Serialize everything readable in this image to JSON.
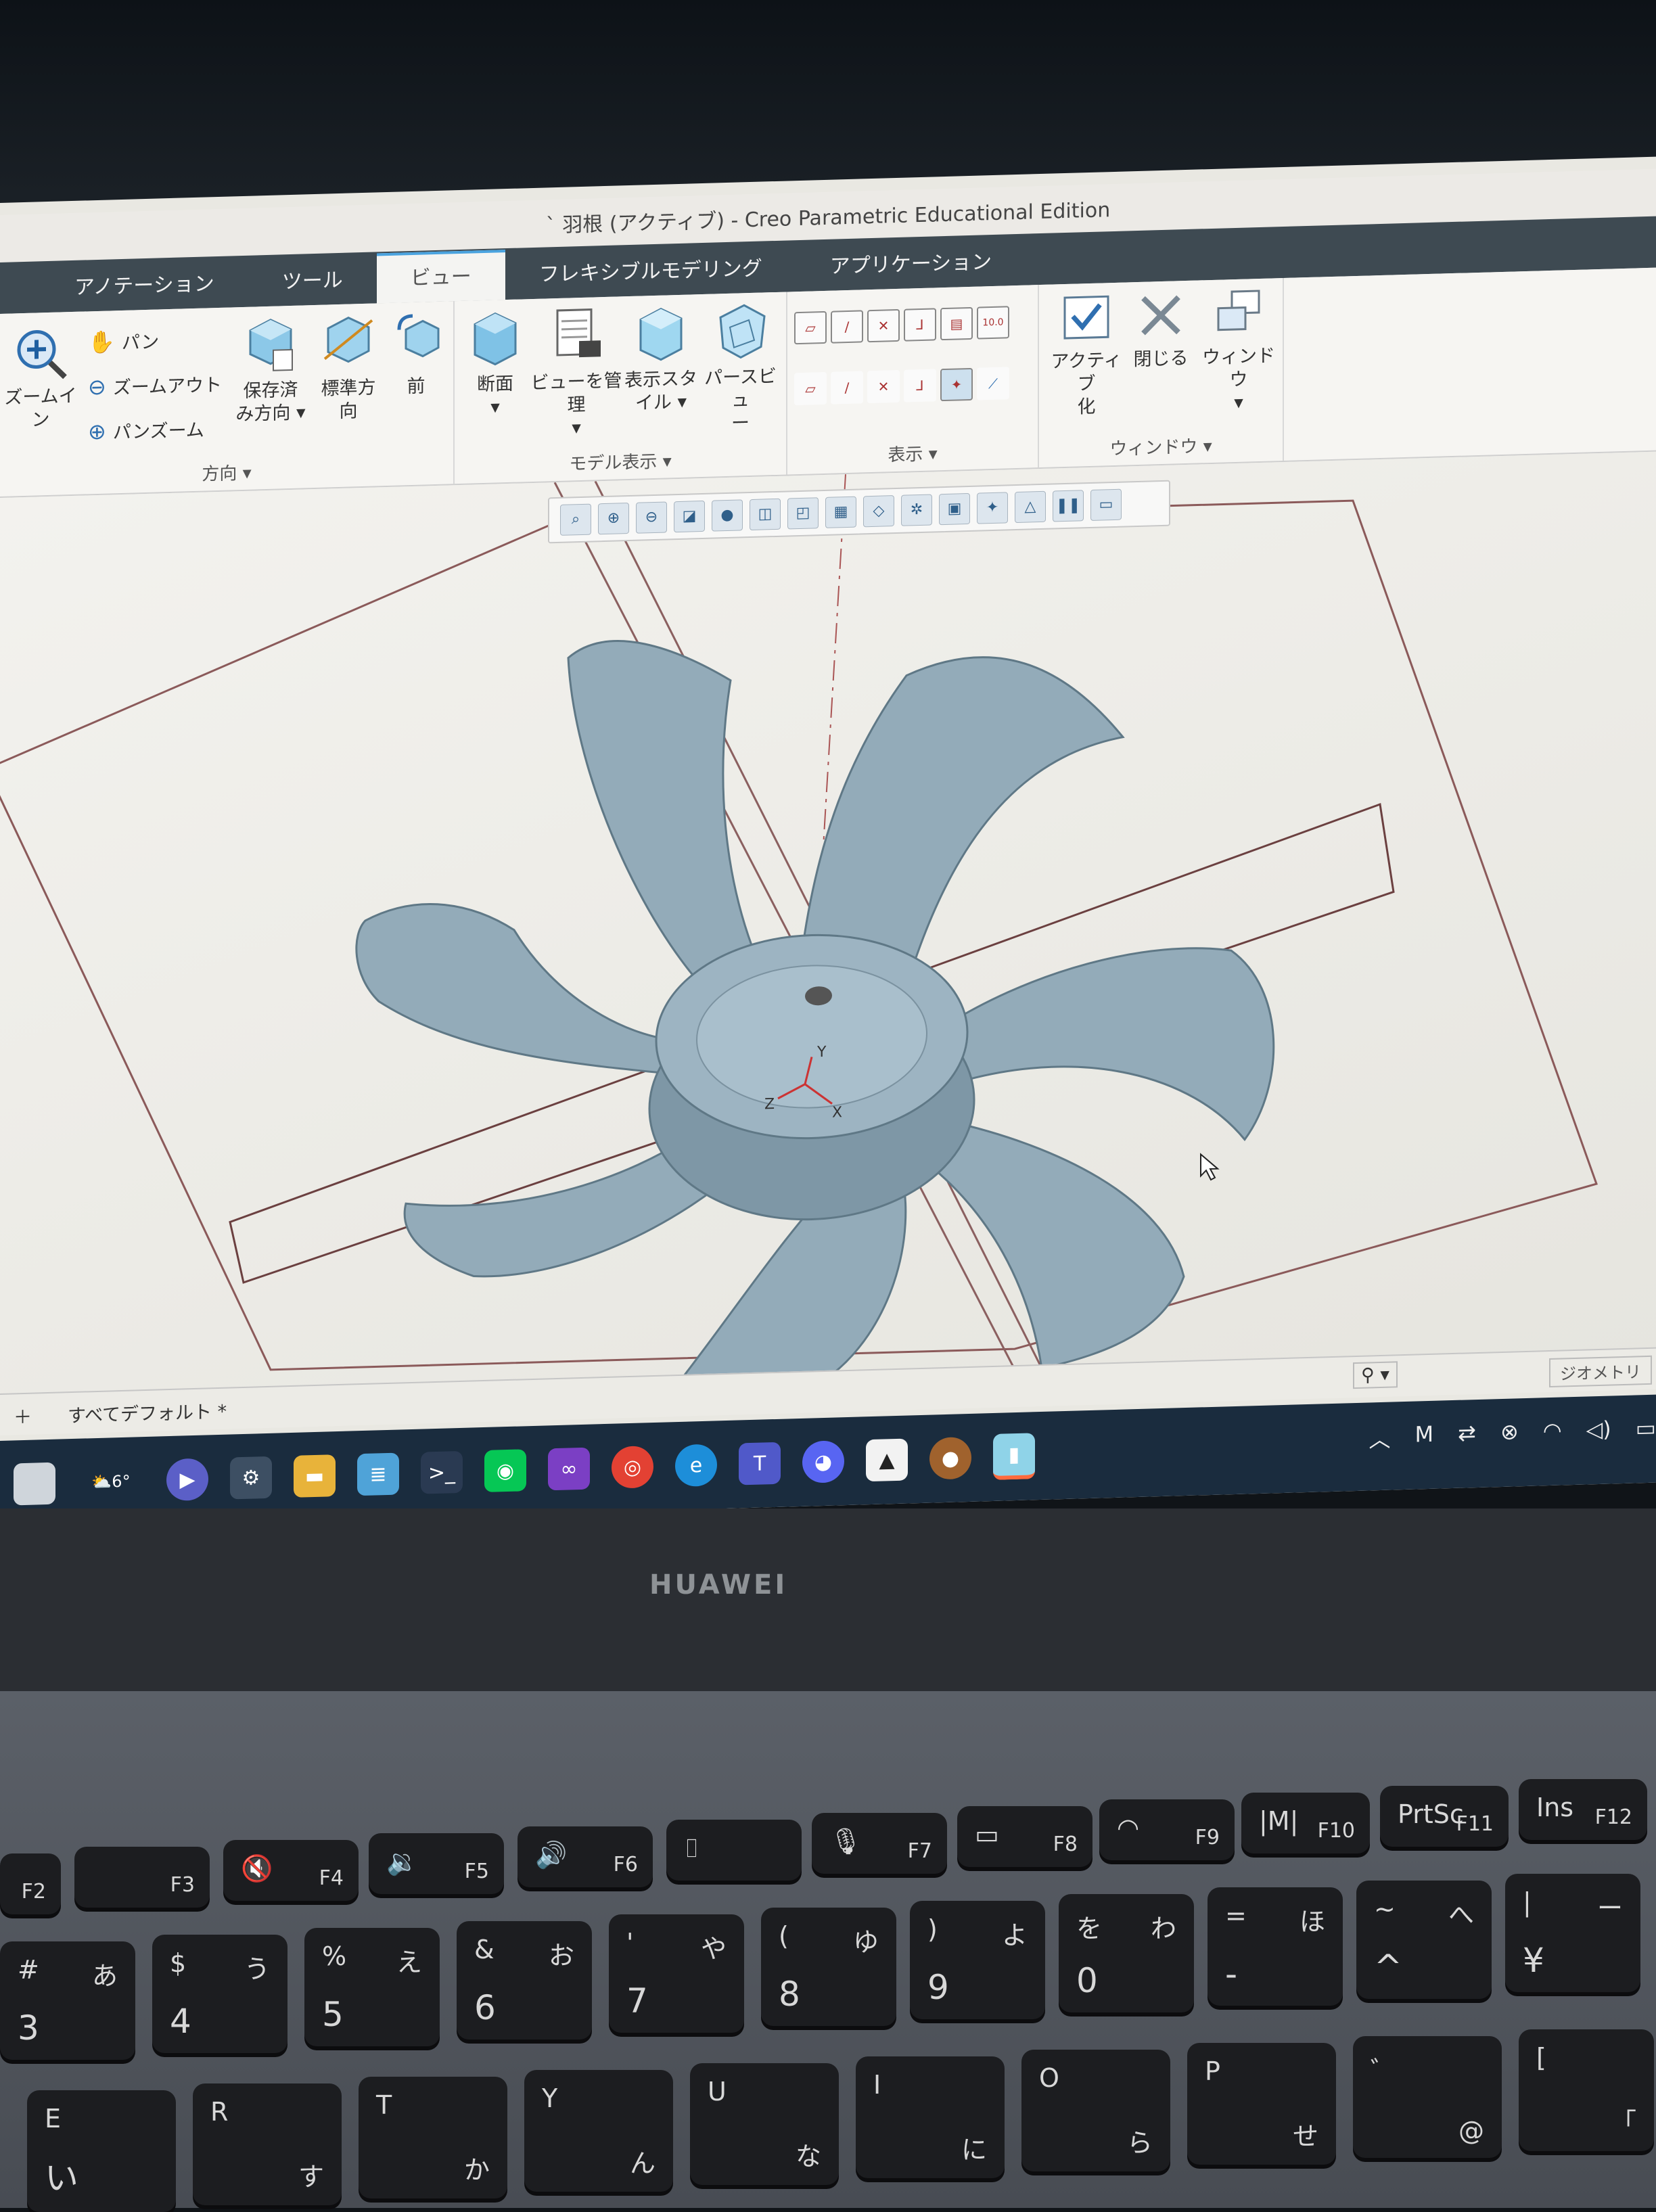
{
  "window": {
    "title": "` 羽根 (アクティブ) - Creo Parametric Educational Edition"
  },
  "tabs": [
    {
      "label": "アノテーション"
    },
    {
      "label": "ツール"
    },
    {
      "label": "ビュー",
      "active": true
    },
    {
      "label": "フレキシブルモデリング"
    },
    {
      "label": "アプリケーション"
    }
  ],
  "ribbon": {
    "orientation": {
      "zoom_in": "ズームイン",
      "pan": "パン",
      "zoom_out": "ズームアウト",
      "pan_zoom": "パンズーム",
      "saved_orientations_1": "保存済",
      "saved_orientations_2": "み方向",
      "standard_orientation_1": "標準方",
      "standard_orientation_2": "向",
      "previous": "前",
      "group_label": "方向"
    },
    "model_display": {
      "section": "断面",
      "manage_views": "ビューを管理",
      "display_style_1": "表示スタ",
      "display_style_2": "イル",
      "perspective_1": "パースビュ",
      "perspective_2": "ー",
      "group_label": "モデル表示"
    },
    "show": {
      "group_label": "表示"
    },
    "window": {
      "activate_1": "アクティブ",
      "activate_2": "化",
      "close": "閉じる",
      "windows": "ウィンドウ",
      "group_label": "ウィンドウ"
    }
  },
  "status_bar": {
    "all_default": "すべてデフォルト *",
    "filter": "ジオメトリ"
  },
  "taskbar": {
    "weather_temp": "6°",
    "apps": [
      "windows-start",
      "weather",
      "zoom",
      "settings",
      "file-explorer",
      "notepad",
      "powershell",
      "line",
      "visual-studio",
      "chrome",
      "edge",
      "teams",
      "discord",
      "onigiri",
      "cookie-clicker",
      "creo"
    ]
  },
  "laptop": {
    "brand": "HUAWEI"
  },
  "keyboard": {
    "function_row": [
      "F2",
      "F3",
      "F4",
      "F5",
      "F6",
      "F7",
      "F8",
      "F9",
      "F10",
      "F11",
      "F12"
    ],
    "function_special": [
      "PrtSc",
      "Ins"
    ],
    "number_row": [
      {
        "big": "3",
        "kana": "あ",
        "top": "#",
        "bottom_kana": "あ"
      },
      {
        "big": "4",
        "kana": "う",
        "top": "$",
        "bottom_kana": "う"
      },
      {
        "big": "5",
        "kana": "え",
        "top": "%",
        "bottom_kana": "え"
      },
      {
        "big": "6",
        "kana": "お",
        "top": "&",
        "bottom_kana": "お"
      },
      {
        "big": "7",
        "kana": "や",
        "top": "'",
        "bottom_kana": "や"
      },
      {
        "big": "8",
        "kana": "ゆ",
        "top": "(",
        "bottom_kana": "ゆ"
      },
      {
        "big": "9",
        "kana": "よ",
        "top": ")",
        "bottom_kana": "よ"
      },
      {
        "big": "0",
        "kana": "わ",
        "top": "",
        "bottom_kana": "を"
      },
      {
        "big": "-",
        "kana": "ほ",
        "top": "=",
        "bottom_kana": "ほ"
      },
      {
        "big": "^",
        "kana": "へ",
        "top": "~",
        "bottom_kana": "へ"
      },
      {
        "big": "¥",
        "kana": "ー",
        "top": "|",
        "bottom_kana": "ー"
      }
    ],
    "letter_row": [
      {
        "big": "E",
        "kana": "い"
      },
      {
        "big": "R",
        "kana": "す"
      },
      {
        "big": "T",
        "kana": "か"
      },
      {
        "big": "Y",
        "kana": "ん"
      },
      {
        "big": "U",
        "kana": "な"
      },
      {
        "big": "I",
        "kana": "に"
      },
      {
        "big": "O",
        "kana": "ら"
      },
      {
        "big": "P",
        "kana": "せ"
      },
      {
        "big": "@",
        "kana": "゛"
      },
      {
        "big": "[",
        "kana": "「"
      }
    ]
  }
}
